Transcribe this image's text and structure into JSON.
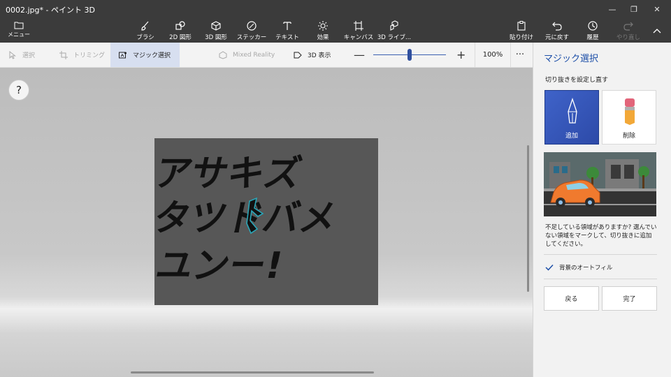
{
  "window": {
    "title": "0002.jpg* - ペイント 3D"
  },
  "ribbon": {
    "menu_label": "メニュー",
    "tools": [
      {
        "label": "ブラシ",
        "icon": "brush-icon"
      },
      {
        "label": "2D 図形",
        "icon": "2d-shapes-icon"
      },
      {
        "label": "3D 図形",
        "icon": "3d-shapes-icon"
      },
      {
        "label": "ステッカー",
        "icon": "sticker-icon"
      },
      {
        "label": "テキスト",
        "icon": "text-icon"
      },
      {
        "label": "効果",
        "icon": "effects-icon"
      },
      {
        "label": "キャンバス",
        "icon": "canvas-icon"
      },
      {
        "label": "3D ライブ...",
        "icon": "3d-library-icon"
      }
    ],
    "actions": [
      {
        "label": "貼り付け",
        "icon": "paste-icon"
      },
      {
        "label": "元に戻す",
        "icon": "undo-icon"
      },
      {
        "label": "履歴",
        "icon": "history-icon"
      },
      {
        "label": "やり直し",
        "icon": "redo-icon"
      }
    ]
  },
  "subtoolbar": {
    "select": "選択",
    "crop": "トリミング",
    "magic_select": "マジック選択",
    "mixed_reality": "Mixed Reality",
    "view_3d": "3D 表示",
    "zoom_minus": "—",
    "zoom_plus": "+",
    "zoom_level": 100,
    "zoom_label": "100%",
    "more": "···"
  },
  "canvas": {
    "text_lines": [
      "アサキズ",
      "タツドバメ",
      "ユンー!"
    ],
    "help": "?"
  },
  "panel": {
    "title": "マジック選択",
    "refine_label": "切り抜きを設定し直す",
    "add_label": "追加",
    "remove_label": "削除",
    "hint": "不足している領域がありますか? 選んでいない領域をマークして、切り抜きに追加してください。",
    "autofill_label": "背景のオートフィル",
    "autofill_checked": true,
    "back_label": "戻る",
    "done_label": "完了"
  },
  "colors": {
    "accent": "#1d4fa8",
    "titlebar": "#3b3b3b",
    "canvas_bg": "#575757",
    "car": "#f07a2e"
  }
}
